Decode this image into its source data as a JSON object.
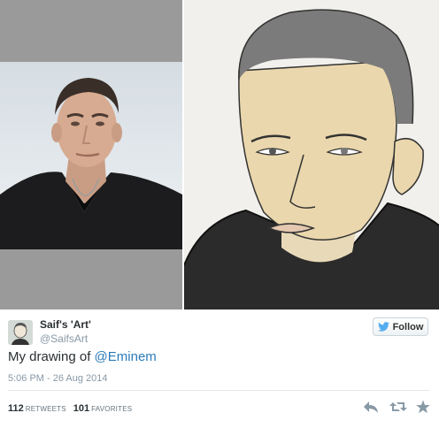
{
  "tweet": {
    "display_name": "Saif's 'Art'",
    "username": "@SaifsArt",
    "text_prefix": "My drawing of ",
    "mention": "@Eminem",
    "timestamp": "5:06 PM - 26 Aug 2014",
    "retweets_count": "112",
    "retweets_label": "RETWEETS",
    "favorites_count": "101",
    "favorites_label": "FAVORITES"
  },
  "follow_button": {
    "label": "Follow"
  },
  "icons": {
    "follow": "twitter-bird-icon",
    "reply": "reply-icon",
    "retweet": "retweet-icon",
    "favorite": "star-icon"
  },
  "colors": {
    "mention": "#2b7bb9",
    "meta": "#8899a6",
    "text": "#292f33",
    "follow_bird": "#55acee"
  }
}
